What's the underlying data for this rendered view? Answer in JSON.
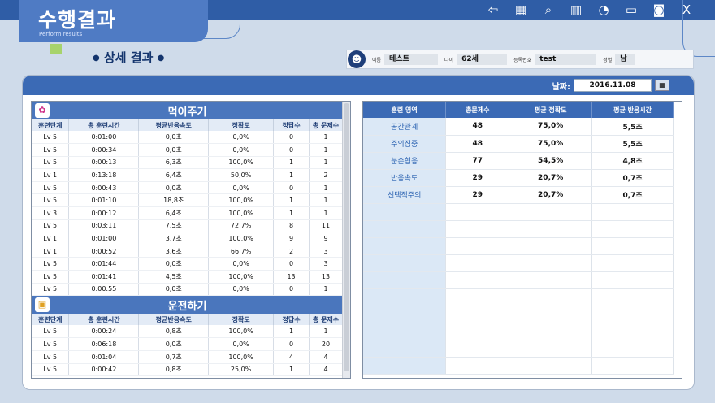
{
  "header": {
    "title": "수행결과",
    "subtitle": "Perform results",
    "toolbar": [
      {
        "name": "back-icon",
        "glyph": "⇦"
      },
      {
        "name": "calendar-icon",
        "glyph": "▦"
      },
      {
        "name": "search-report-icon",
        "glyph": "⌕"
      },
      {
        "name": "bar-chart-icon",
        "glyph": "▥"
      },
      {
        "name": "pie-chart-icon",
        "glyph": "◔"
      },
      {
        "name": "monitor-icon",
        "glyph": "▭"
      },
      {
        "name": "camera-icon",
        "glyph": "◙"
      },
      {
        "name": "excel-icon",
        "glyph": "X"
      }
    ]
  },
  "section": {
    "title": "상세 결과"
  },
  "user": {
    "name_label": "이름",
    "name": "테스트",
    "age_label": "나이",
    "age": "62세",
    "id_label": "등록번호",
    "id": "test",
    "gender_label": "성별",
    "gender": "남"
  },
  "date": {
    "label": "날짜:",
    "value": "2016.11.08"
  },
  "columns": [
    "훈련단계",
    "총 훈련시간",
    "평균반응속도",
    "정확도",
    "정답수",
    "총 문제수"
  ],
  "game1": {
    "title": "먹이주기",
    "rows": [
      [
        "Lv 5",
        "0:01:00",
        "0,0초",
        "0,0%",
        "0",
        "1"
      ],
      [
        "Lv 5",
        "0:00:34",
        "0,0초",
        "0,0%",
        "0",
        "1"
      ],
      [
        "Lv 5",
        "0:00:13",
        "6,3초",
        "100,0%",
        "1",
        "1"
      ],
      [
        "Lv 1",
        "0:13:18",
        "6,4초",
        "50,0%",
        "1",
        "2"
      ],
      [
        "Lv 5",
        "0:00:43",
        "0,0초",
        "0,0%",
        "0",
        "1"
      ],
      [
        "Lv 5",
        "0:01:10",
        "18,8초",
        "100,0%",
        "1",
        "1"
      ],
      [
        "Lv 3",
        "0:00:12",
        "6,4초",
        "100,0%",
        "1",
        "1"
      ],
      [
        "Lv 5",
        "0:03:11",
        "7,5초",
        "72,7%",
        "8",
        "11"
      ],
      [
        "Lv 1",
        "0:01:00",
        "3,7초",
        "100,0%",
        "9",
        "9"
      ],
      [
        "Lv 1",
        "0:00:52",
        "3,6초",
        "66,7%",
        "2",
        "3"
      ],
      [
        "Lv 5",
        "0:01:44",
        "0,0초",
        "0,0%",
        "0",
        "3"
      ],
      [
        "Lv 5",
        "0:01:41",
        "4,5초",
        "100,0%",
        "13",
        "13"
      ],
      [
        "Lv 5",
        "0:00:55",
        "0,0초",
        "0,0%",
        "0",
        "1"
      ]
    ]
  },
  "game2": {
    "title": "운전하기",
    "rows": [
      [
        "Lv 5",
        "0:00:24",
        "0,8초",
        "100,0%",
        "1",
        "1"
      ],
      [
        "Lv 5",
        "0:06:18",
        "0,0초",
        "0,0%",
        "0",
        "20"
      ],
      [
        "Lv 5",
        "0:01:04",
        "0,7초",
        "100,0%",
        "4",
        "4"
      ],
      [
        "Lv 5",
        "0:00:42",
        "0,8초",
        "25,0%",
        "1",
        "4"
      ]
    ]
  },
  "summary": {
    "columns": [
      "훈련 영역",
      "총문제수",
      "평균 정확도",
      "평균 반응시간"
    ],
    "rows": [
      [
        "공간관계",
        "48",
        "75,0%",
        "5,5초"
      ],
      [
        "주의집중",
        "48",
        "75,0%",
        "5,5초"
      ],
      [
        "눈손협응",
        "77",
        "54,5%",
        "4,8초"
      ],
      [
        "반응속도",
        "29",
        "20,7%",
        "0,7초"
      ],
      [
        "선택적주의",
        "29",
        "20,7%",
        "0,7초"
      ]
    ]
  },
  "colors": {
    "header_blue": "#2f5da6",
    "panel_blue": "#3b6ab5",
    "accent_green": "#a7d36c"
  }
}
